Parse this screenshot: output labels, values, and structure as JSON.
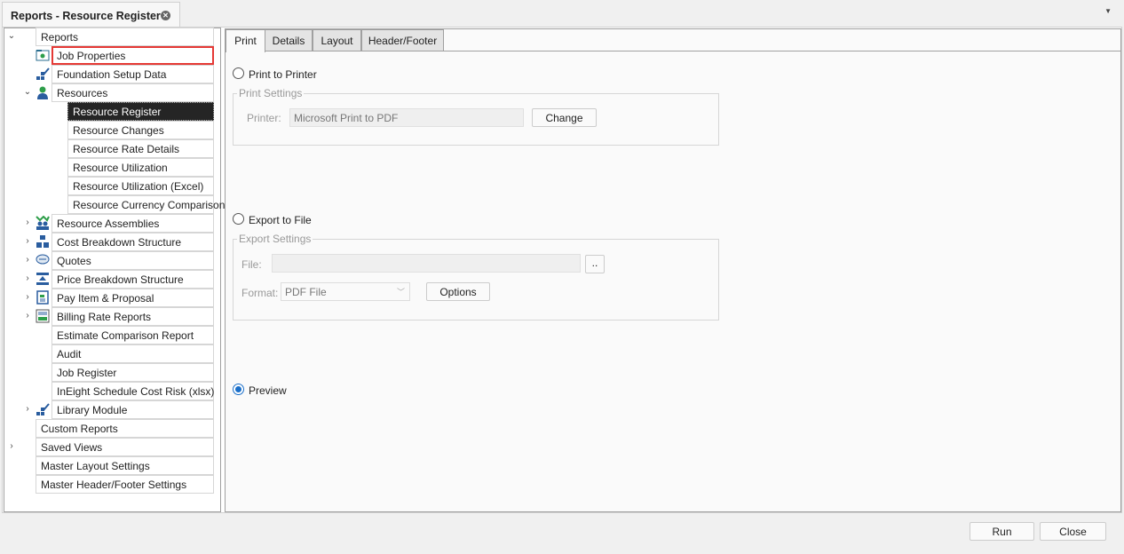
{
  "window": {
    "title": "Reports - Resource Register"
  },
  "tree": {
    "root": "Reports",
    "items": [
      {
        "label": "Job Properties",
        "icon": "job-properties-icon"
      },
      {
        "label": "Foundation Setup Data",
        "icon": "foundation-icon"
      },
      {
        "label": "Resources",
        "icon": "resources-icon",
        "expanded": true
      },
      {
        "label": "Resource Register",
        "child": true,
        "selected": true
      },
      {
        "label": "Resource Changes",
        "child": true
      },
      {
        "label": "Resource Rate Details",
        "child": true
      },
      {
        "label": "Resource Utilization",
        "child": true
      },
      {
        "label": "Resource Utilization (Excel)",
        "child": true
      },
      {
        "label": "Resource Currency Comparison",
        "child": true
      },
      {
        "label": "Resource Assemblies",
        "icon": "resource-assemblies-icon"
      },
      {
        "label": "Cost Breakdown Structure",
        "icon": "cbs-icon"
      },
      {
        "label": "Quotes",
        "icon": "quotes-icon"
      },
      {
        "label": "Price Breakdown Structure",
        "icon": "pbs-icon"
      },
      {
        "label": "Pay Item & Proposal",
        "icon": "pay-item-icon"
      },
      {
        "label": "Billing Rate Reports",
        "icon": "billing-rate-icon"
      },
      {
        "label": "Estimate Comparison Report"
      },
      {
        "label": "Audit"
      },
      {
        "label": "Job Register"
      },
      {
        "label": "InEight Schedule Cost Risk (xlsx)"
      },
      {
        "label": "Library Module",
        "icon": "library-icon"
      }
    ],
    "top": [
      "Custom Reports",
      "Saved Views",
      "Master Layout Settings",
      "Master Header/Footer Settings"
    ]
  },
  "tabs": [
    "Print",
    "Details",
    "Layout",
    "Header/Footer"
  ],
  "print": {
    "print_to_printer": "Print to Printer",
    "print_settings": "Print Settings",
    "printer_label": "Printer:",
    "printer_value": "Microsoft Print to PDF",
    "change": "Change",
    "export_to_file": "Export to File",
    "export_settings": "Export Settings",
    "file_label": "File:",
    "file_value": "",
    "browse": "..",
    "format_label": "Format:",
    "format_value": "PDF File",
    "options": "Options",
    "preview": "Preview"
  },
  "footer": {
    "run": "Run",
    "close": "Close"
  }
}
